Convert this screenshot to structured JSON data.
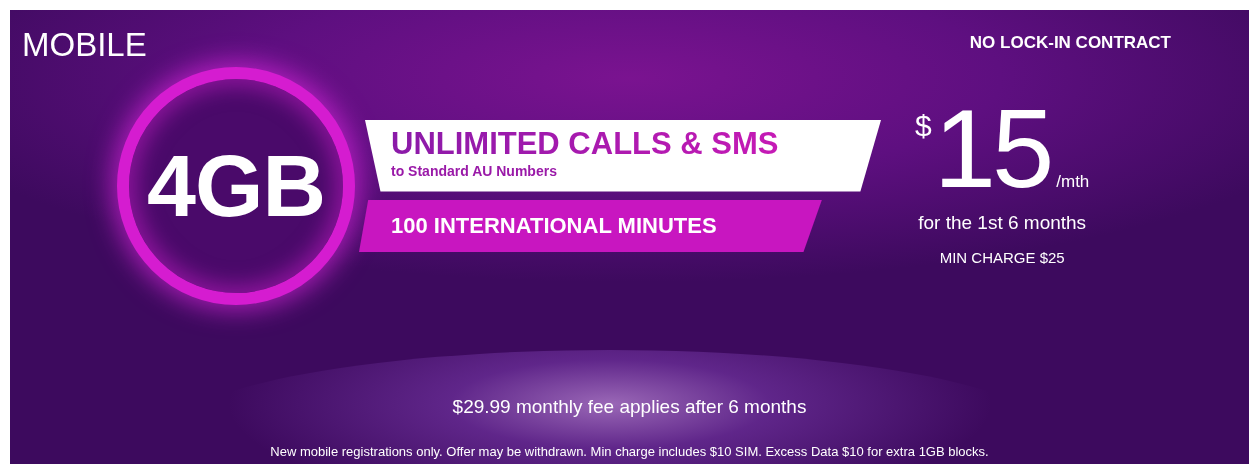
{
  "heading": "MOBILE",
  "contract_note": "NO LOCK-IN CONTRACT",
  "data_allowance": "4GB",
  "features": [
    {
      "kind": "white",
      "title": "UNLIMITED CALLS & SMS",
      "subtitle": "to Standard AU Numbers"
    },
    {
      "kind": "magenta",
      "title": "100 INTERNATIONAL MINUTES"
    }
  ],
  "price": {
    "currency": "$",
    "amount": "15",
    "period": "/mth",
    "duration": "for the 1st 6 months",
    "min_charge": "MIN CHARGE $25"
  },
  "after_fee": "$29.99 monthly fee applies after 6 months",
  "fine_print": "New mobile registrations only. Offer may be withdrawn. Min charge includes $10 SIM. Excess Data $10 for extra 1GB blocks."
}
